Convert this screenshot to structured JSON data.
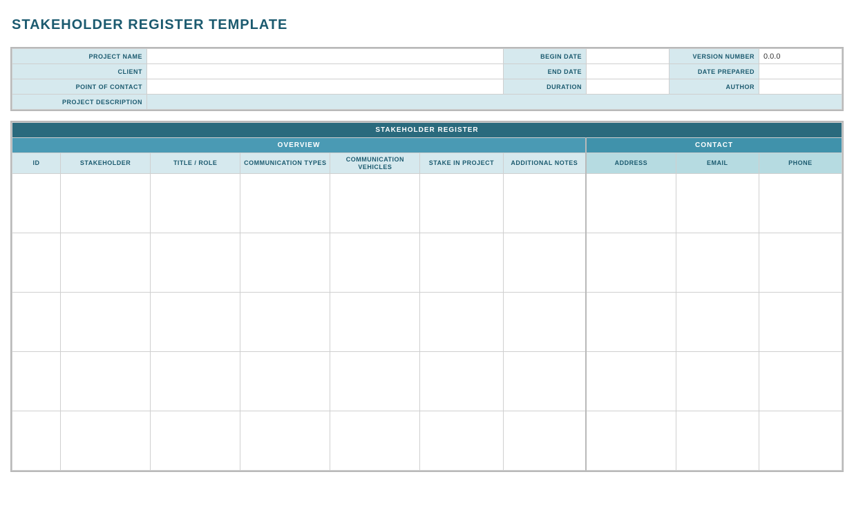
{
  "title": "STAKEHOLDER REGISTER TEMPLATE",
  "info_labels": {
    "project_name": "PROJECT NAME",
    "client": "CLIENT",
    "point_of_contact": "POINT OF CONTACT",
    "project_description": "PROJECT DESCRIPTION",
    "begin_date": "BEGIN DATE",
    "end_date": "END DATE",
    "duration": "DURATION",
    "version_number": "VERSION NUMBER",
    "date_prepared": "DATE PREPARED",
    "author": "AUTHOR"
  },
  "info_values": {
    "project_name": "",
    "client": "",
    "point_of_contact": "",
    "project_description": "",
    "begin_date": "",
    "end_date": "",
    "duration": "",
    "version_number": "0.0.0",
    "date_prepared": "",
    "author": ""
  },
  "reg": {
    "main_header": "STAKEHOLDER REGISTER",
    "overview_header": "OVERVIEW",
    "contact_header": "CONTACT",
    "cols": {
      "id": "ID",
      "stakeholder": "STAKEHOLDER",
      "title_role": "TITLE / ROLE",
      "comm_types": "COMMUNICATION TYPES",
      "comm_vehicles": "COMMUNICATION VEHICLES",
      "stake": "STAKE IN PROJECT",
      "notes": "ADDITIONAL NOTES",
      "address": "ADDRESS",
      "email": "EMAIL",
      "phone": "PHONE"
    },
    "rows": [
      {
        "id": "",
        "stakeholder": "",
        "title_role": "",
        "comm_types": "",
        "comm_vehicles": "",
        "stake": "",
        "notes": "",
        "address": "",
        "email": "",
        "phone": ""
      },
      {
        "id": "",
        "stakeholder": "",
        "title_role": "",
        "comm_types": "",
        "comm_vehicles": "",
        "stake": "",
        "notes": "",
        "address": "",
        "email": "",
        "phone": ""
      },
      {
        "id": "",
        "stakeholder": "",
        "title_role": "",
        "comm_types": "",
        "comm_vehicles": "",
        "stake": "",
        "notes": "",
        "address": "",
        "email": "",
        "phone": ""
      },
      {
        "id": "",
        "stakeholder": "",
        "title_role": "",
        "comm_types": "",
        "comm_vehicles": "",
        "stake": "",
        "notes": "",
        "address": "",
        "email": "",
        "phone": ""
      },
      {
        "id": "",
        "stakeholder": "",
        "title_role": "",
        "comm_types": "",
        "comm_vehicles": "",
        "stake": "",
        "notes": "",
        "address": "",
        "email": "",
        "phone": ""
      }
    ]
  }
}
